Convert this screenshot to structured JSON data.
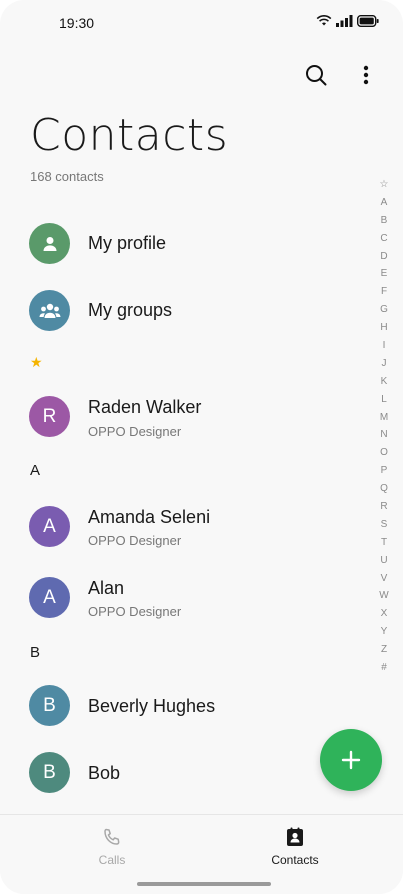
{
  "status_bar": {
    "time": "19:30"
  },
  "header": {
    "title": "Contacts",
    "count": "168 contacts"
  },
  "items": {
    "my_profile": "My profile",
    "my_groups": "My groups"
  },
  "favorites_marker": "★",
  "sections": {
    "a": "A",
    "b": "B"
  },
  "contacts": [
    {
      "initial": "R",
      "name": "Raden Walker",
      "subtitle": "OPPO Designer",
      "color": "#9c58a5"
    },
    {
      "initial": "A",
      "name": "Amanda Seleni",
      "subtitle": "OPPO Designer",
      "color": "#7a5cb0"
    },
    {
      "initial": "A",
      "name": "Alan",
      "subtitle": "OPPO Designer",
      "color": "#5f6ab0"
    },
    {
      "initial": "B",
      "name": "Beverly Hughes",
      "subtitle": "",
      "color": "#4f8aa3"
    },
    {
      "initial": "B",
      "name": "Bob",
      "subtitle": "",
      "color": "#4e8a7e"
    }
  ],
  "index_letters": [
    "☆",
    "A",
    "B",
    "C",
    "D",
    "E",
    "F",
    "G",
    "H",
    "I",
    "J",
    "K",
    "L",
    "M",
    "N",
    "O",
    "P",
    "Q",
    "R",
    "S",
    "T",
    "U",
    "V",
    "W",
    "X",
    "Y",
    "Z",
    "#"
  ],
  "bottom_nav": {
    "calls": "Calls",
    "contacts": "Contacts"
  },
  "colors": {
    "accent_green": "#2fb35a",
    "profile_avatar": "#5a9a6a",
    "groups_avatar": "#4f8aa3",
    "star": "#f5b400"
  },
  "icons": {
    "search": "search-icon",
    "more": "more-vertical-icon",
    "wifi": "wifi-icon",
    "signal": "signal-icon",
    "battery": "battery-icon",
    "add": "plus-icon",
    "calls": "phone-icon",
    "contacts": "contacts-book-icon"
  }
}
